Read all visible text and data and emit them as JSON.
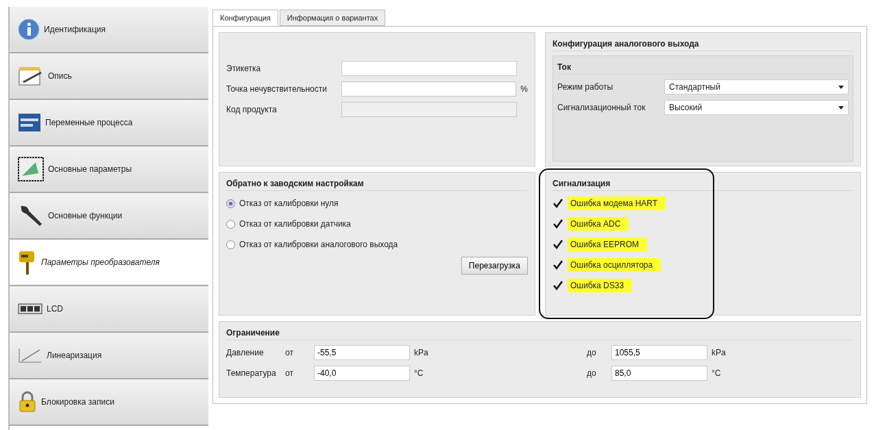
{
  "sidebar": {
    "items": [
      {
        "label": "Идентификация",
        "selected": false
      },
      {
        "label": "Опись",
        "selected": false
      },
      {
        "label": "Переменные процесса",
        "selected": false
      },
      {
        "label": "Основные параметры",
        "selected": false
      },
      {
        "label": "Основные функции",
        "selected": false
      },
      {
        "label": "Параметры преобразователя",
        "selected": true
      },
      {
        "label": "LCD",
        "selected": false
      },
      {
        "label": "Линеаризация",
        "selected": false
      },
      {
        "label": "Блокировка записи",
        "selected": false
      }
    ]
  },
  "tabs": [
    {
      "label": "Конфигурация",
      "selected": true
    },
    {
      "label": "Информация о вариантах",
      "selected": false
    }
  ],
  "general": {
    "fields": [
      {
        "label": "Этикетка"
      },
      {
        "label": "Точка нечувствительности",
        "unit": "%"
      },
      {
        "label": "Код продукта",
        "disabled": true
      }
    ]
  },
  "analog_output": {
    "title": "Конфигурация аналогового выхода",
    "current": {
      "title": "Ток",
      "fields": [
        {
          "label": "Режим работы",
          "value": "Стандартный"
        },
        {
          "label": "Сигнализационный ток",
          "value": "Высокий"
        }
      ]
    }
  },
  "factory_reset": {
    "title": "Обратно к заводским настройкам",
    "options": [
      {
        "label": "Отказ от калибровки нуля",
        "selected": true
      },
      {
        "label": "Отказ от калибровки датчика",
        "selected": false
      },
      {
        "label": "Отказ от калибровки аналогового выхода",
        "selected": false
      }
    ],
    "button": "Перезагрузка"
  },
  "alarms": {
    "title": "Сигнализация",
    "outlined": true,
    "items": [
      {
        "label": "Ошибка модема HART",
        "checked": true,
        "highlighted": true
      },
      {
        "label": "Ошибка ADC",
        "checked": true,
        "highlighted": true
      },
      {
        "label": "Ошибка EEPROM",
        "checked": true,
        "highlighted": true
      },
      {
        "label": "Ошибка осциллятора",
        "checked": true,
        "highlighted": true
      },
      {
        "label": "Ошибка DS33",
        "checked": true,
        "highlighted": true
      }
    ]
  },
  "limits": {
    "title": "Ограничение",
    "rows": [
      {
        "label": "Давление",
        "from_label": "от",
        "from": "-55,5",
        "from_unit": "kPa",
        "to_label": "до",
        "to": "1055,5",
        "to_unit": "kPa"
      },
      {
        "label": "Температура",
        "from_label": "от",
        "from": "-40,0",
        "from_unit": "°C",
        "to_label": "до",
        "to": "85,0",
        "to_unit": "°C"
      }
    ]
  }
}
